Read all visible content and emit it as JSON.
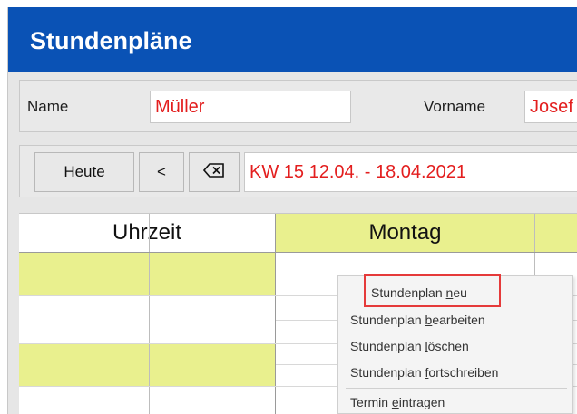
{
  "window": {
    "title": "Stundenpläne"
  },
  "person": {
    "name_label": "Name",
    "name_value": "Müller",
    "vorname_label": "Vorname",
    "vorname_value": "Josef"
  },
  "nav": {
    "today_label": "Heute",
    "prev_label": "<",
    "clear_icon": "backspace-icon",
    "week_value": "KW 15 12.04. - 18.04.2021"
  },
  "grid": {
    "headers": [
      "Uhrzeit",
      "Montag"
    ]
  },
  "context_menu": {
    "items": [
      {
        "prefix": "Stundenplan ",
        "key": "n",
        "suffix": "eu"
      },
      {
        "prefix": "Stundenplan ",
        "key": "b",
        "suffix": "earbeiten"
      },
      {
        "prefix": "Stundenplan ",
        "key": "l",
        "suffix": "öschen"
      },
      {
        "prefix": "Stundenplan ",
        "key": "f",
        "suffix": "ortschreiben"
      },
      {
        "prefix": "Termin ",
        "key": "e",
        "suffix": "intragen"
      }
    ]
  },
  "colors": {
    "titlebar": "#0a52b5",
    "highlight_row": "#e9f08e",
    "value_text": "#e31e1e",
    "callout_border": "#e53a3a"
  }
}
